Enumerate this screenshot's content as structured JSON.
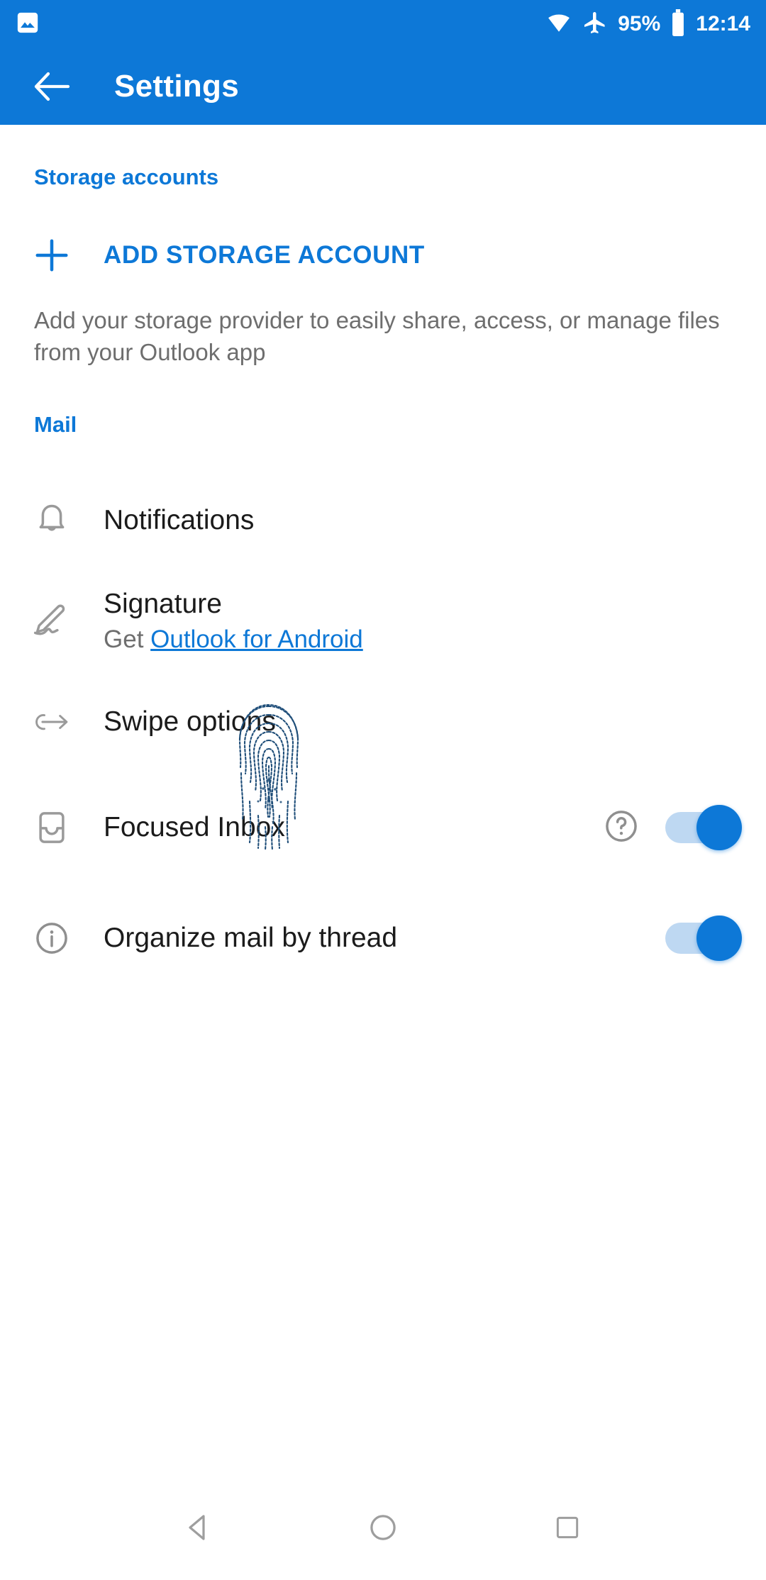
{
  "status_bar": {
    "notification_icon": "image-icon",
    "wifi_icon": "wifi-icon",
    "airplane_icon": "airplane-mode-icon",
    "battery_percent": "95%",
    "battery_icon": "battery-icon",
    "time": "12:14"
  },
  "app_bar": {
    "back_icon": "back-arrow-icon",
    "title": "Settings"
  },
  "sections": {
    "storage": {
      "header": "Storage accounts",
      "add_button": {
        "icon": "plus-icon",
        "label": "ADD STORAGE ACCOUNT"
      },
      "description": "Add your storage provider to easily share, access, or manage files from your Outlook app"
    },
    "mail": {
      "header": "Mail",
      "rows": [
        {
          "icon": "bell-icon",
          "title": "Notifications",
          "subtitle": "",
          "subtitle_link": "",
          "has_help": false,
          "has_toggle": false,
          "toggle_on": false
        },
        {
          "icon": "pen-signature-icon",
          "title": "Signature",
          "subtitle_prefix": "Get ",
          "subtitle_link": "Outlook for Android",
          "has_help": false,
          "has_toggle": false,
          "toggle_on": false
        },
        {
          "icon": "swipe-arrow-icon",
          "title": "Swipe options",
          "subtitle": "",
          "has_help": false,
          "has_toggle": false,
          "toggle_on": false
        },
        {
          "icon": "inbox-icon",
          "title": "Focused Inbox",
          "subtitle": "",
          "has_help": true,
          "help_icon": "question-mark-circle-icon",
          "has_toggle": true,
          "toggle_on": true
        },
        {
          "icon": "info-circle-icon",
          "title": "Organize mail by thread",
          "subtitle": "",
          "has_help": false,
          "has_toggle": true,
          "toggle_on": true
        }
      ]
    }
  },
  "overlay": {
    "fingerprint_icon": "fingerprint-icon"
  },
  "nav_bar": {
    "back": "nav-back-icon",
    "home": "nav-home-icon",
    "recents": "nav-recents-icon"
  },
  "colors": {
    "accent": "#0d78d7",
    "appbar": "#0d78d7",
    "toggle_track": "#bed8f2",
    "toggle_thumb": "#0d78d7",
    "text_primary": "#1b1b1b",
    "text_secondary": "#6e6e6e",
    "icon_grey": "#8f8f8f"
  }
}
